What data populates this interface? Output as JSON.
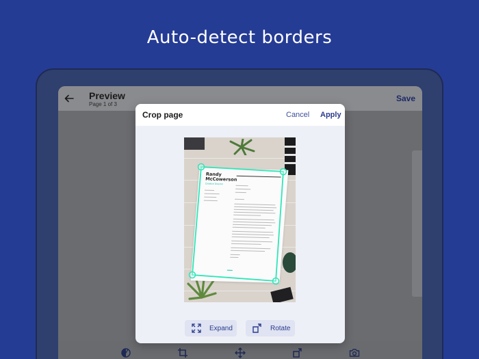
{
  "headline": "Auto-detect borders",
  "appbar": {
    "title": "Preview",
    "subtitle": "Page 1 of 3",
    "save_label": "Save"
  },
  "dialog": {
    "title": "Crop page",
    "cancel_label": "Cancel",
    "apply_label": "Apply",
    "expand_label": "Expand",
    "rotate_label": "Rotate"
  },
  "document": {
    "name_line1": "Randy",
    "name_line2": "McCowerson",
    "role": "Creative Director"
  },
  "toolbar": {
    "icons": [
      "filter-icon",
      "crop-icon",
      "move-icon",
      "rotate-icon",
      "camera-icon"
    ]
  },
  "colors": {
    "background": "#253c95",
    "accent": "#2a3a8c",
    "crop_outline": "#2ee6b8"
  }
}
